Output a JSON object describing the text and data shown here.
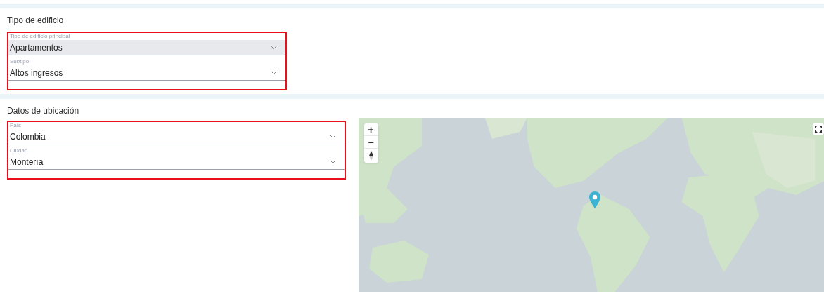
{
  "sections": [
    {
      "title": "Tipo de edificio",
      "fields": [
        {
          "label": "Tipo de edificio principal",
          "value": "Apartamentos",
          "focused": true
        },
        {
          "label": "Subtipo",
          "value": "Altos ingresos",
          "focused": false
        }
      ]
    },
    {
      "title": "Datos de ubicación",
      "fields": [
        {
          "label": "País",
          "value": "Colombia",
          "focused": false
        },
        {
          "label": "Ciudad",
          "value": "Montería",
          "focused": false
        }
      ],
      "map": {
        "kind": "picture",
        "zoom_in": "+",
        "zoom_out": "−"
      }
    }
  ]
}
